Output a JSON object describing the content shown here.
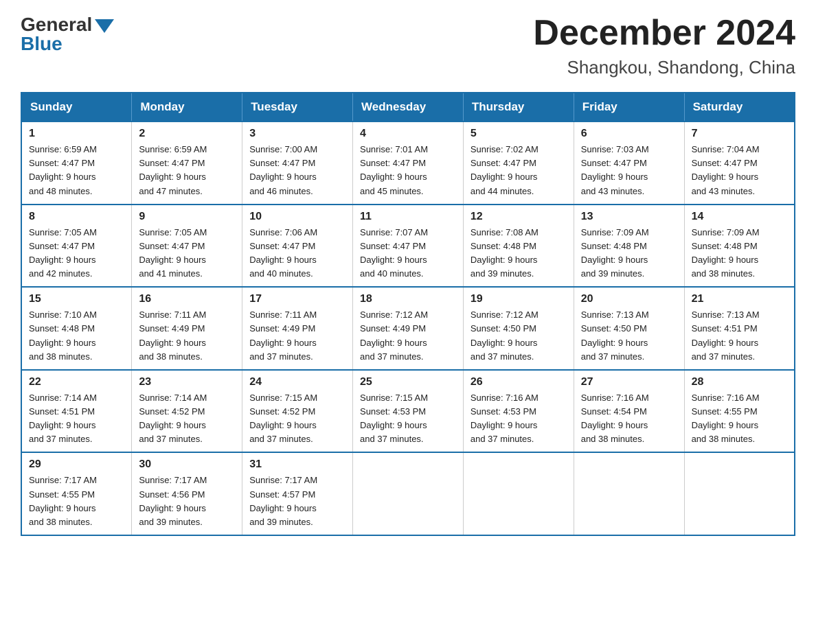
{
  "logo": {
    "general": "General",
    "blue": "Blue"
  },
  "title": "December 2024",
  "subtitle": "Shangkou, Shandong, China",
  "weekdays": [
    "Sunday",
    "Monday",
    "Tuesday",
    "Wednesday",
    "Thursday",
    "Friday",
    "Saturday"
  ],
  "weeks": [
    [
      {
        "day": "1",
        "sunrise": "6:59 AM",
        "sunset": "4:47 PM",
        "daylight": "9 hours and 48 minutes."
      },
      {
        "day": "2",
        "sunrise": "6:59 AM",
        "sunset": "4:47 PM",
        "daylight": "9 hours and 47 minutes."
      },
      {
        "day": "3",
        "sunrise": "7:00 AM",
        "sunset": "4:47 PM",
        "daylight": "9 hours and 46 minutes."
      },
      {
        "day": "4",
        "sunrise": "7:01 AM",
        "sunset": "4:47 PM",
        "daylight": "9 hours and 45 minutes."
      },
      {
        "day": "5",
        "sunrise": "7:02 AM",
        "sunset": "4:47 PM",
        "daylight": "9 hours and 44 minutes."
      },
      {
        "day": "6",
        "sunrise": "7:03 AM",
        "sunset": "4:47 PM",
        "daylight": "9 hours and 43 minutes."
      },
      {
        "day": "7",
        "sunrise": "7:04 AM",
        "sunset": "4:47 PM",
        "daylight": "9 hours and 43 minutes."
      }
    ],
    [
      {
        "day": "8",
        "sunrise": "7:05 AM",
        "sunset": "4:47 PM",
        "daylight": "9 hours and 42 minutes."
      },
      {
        "day": "9",
        "sunrise": "7:05 AM",
        "sunset": "4:47 PM",
        "daylight": "9 hours and 41 minutes."
      },
      {
        "day": "10",
        "sunrise": "7:06 AM",
        "sunset": "4:47 PM",
        "daylight": "9 hours and 40 minutes."
      },
      {
        "day": "11",
        "sunrise": "7:07 AM",
        "sunset": "4:47 PM",
        "daylight": "9 hours and 40 minutes."
      },
      {
        "day": "12",
        "sunrise": "7:08 AM",
        "sunset": "4:48 PM",
        "daylight": "9 hours and 39 minutes."
      },
      {
        "day": "13",
        "sunrise": "7:09 AM",
        "sunset": "4:48 PM",
        "daylight": "9 hours and 39 minutes."
      },
      {
        "day": "14",
        "sunrise": "7:09 AM",
        "sunset": "4:48 PM",
        "daylight": "9 hours and 38 minutes."
      }
    ],
    [
      {
        "day": "15",
        "sunrise": "7:10 AM",
        "sunset": "4:48 PM",
        "daylight": "9 hours and 38 minutes."
      },
      {
        "day": "16",
        "sunrise": "7:11 AM",
        "sunset": "4:49 PM",
        "daylight": "9 hours and 38 minutes."
      },
      {
        "day": "17",
        "sunrise": "7:11 AM",
        "sunset": "4:49 PM",
        "daylight": "9 hours and 37 minutes."
      },
      {
        "day": "18",
        "sunrise": "7:12 AM",
        "sunset": "4:49 PM",
        "daylight": "9 hours and 37 minutes."
      },
      {
        "day": "19",
        "sunrise": "7:12 AM",
        "sunset": "4:50 PM",
        "daylight": "9 hours and 37 minutes."
      },
      {
        "day": "20",
        "sunrise": "7:13 AM",
        "sunset": "4:50 PM",
        "daylight": "9 hours and 37 minutes."
      },
      {
        "day": "21",
        "sunrise": "7:13 AM",
        "sunset": "4:51 PM",
        "daylight": "9 hours and 37 minutes."
      }
    ],
    [
      {
        "day": "22",
        "sunrise": "7:14 AM",
        "sunset": "4:51 PM",
        "daylight": "9 hours and 37 minutes."
      },
      {
        "day": "23",
        "sunrise": "7:14 AM",
        "sunset": "4:52 PM",
        "daylight": "9 hours and 37 minutes."
      },
      {
        "day": "24",
        "sunrise": "7:15 AM",
        "sunset": "4:52 PM",
        "daylight": "9 hours and 37 minutes."
      },
      {
        "day": "25",
        "sunrise": "7:15 AM",
        "sunset": "4:53 PM",
        "daylight": "9 hours and 37 minutes."
      },
      {
        "day": "26",
        "sunrise": "7:16 AM",
        "sunset": "4:53 PM",
        "daylight": "9 hours and 37 minutes."
      },
      {
        "day": "27",
        "sunrise": "7:16 AM",
        "sunset": "4:54 PM",
        "daylight": "9 hours and 38 minutes."
      },
      {
        "day": "28",
        "sunrise": "7:16 AM",
        "sunset": "4:55 PM",
        "daylight": "9 hours and 38 minutes."
      }
    ],
    [
      {
        "day": "29",
        "sunrise": "7:17 AM",
        "sunset": "4:55 PM",
        "daylight": "9 hours and 38 minutes."
      },
      {
        "day": "30",
        "sunrise": "7:17 AM",
        "sunset": "4:56 PM",
        "daylight": "9 hours and 39 minutes."
      },
      {
        "day": "31",
        "sunrise": "7:17 AM",
        "sunset": "4:57 PM",
        "daylight": "9 hours and 39 minutes."
      },
      null,
      null,
      null,
      null
    ]
  ],
  "labels": {
    "sunrise": "Sunrise:",
    "sunset": "Sunset:",
    "daylight": "Daylight:"
  }
}
